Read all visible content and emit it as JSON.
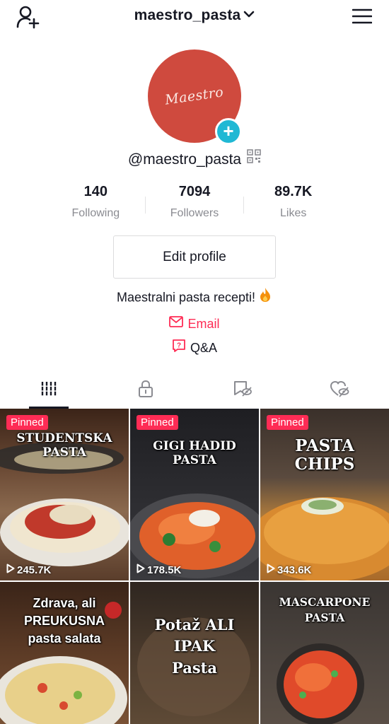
{
  "header": {
    "username": "maestro_pasta",
    "icons": {
      "left": "add-user-icon",
      "dropdown": "chevron-down-icon",
      "right": "hamburger-menu-icon"
    }
  },
  "profile": {
    "avatar_text": "Maestro",
    "handle": "@maestro_pasta",
    "bio": "Maestralni pasta recepti!",
    "bio_emoji": "fire-icon",
    "edit_label": "Edit profile",
    "email_label": "Email",
    "qa_label": "Q&A"
  },
  "stats": [
    {
      "value": "140",
      "label": "Following"
    },
    {
      "value": "7094",
      "label": "Followers"
    },
    {
      "value": "89.7K",
      "label": "Likes"
    }
  ],
  "tabs": [
    "videos-grid-icon",
    "private-lock-icon",
    "reposts-icon",
    "liked-hidden-icon"
  ],
  "videos": [
    {
      "pinned": "Pinned",
      "title": "STUDENTSKA PASTA",
      "views": "245.7K"
    },
    {
      "pinned": "Pinned",
      "title": "GIGI HADID PASTA",
      "views": "178.5K"
    },
    {
      "pinned": "Pinned",
      "title": "PASTA CHIPS",
      "views": "343.6K"
    },
    {
      "title": "Zdrava, ali PREUKUSNA pasta salata"
    },
    {
      "title": "Potaž ALI IPAK Pasta"
    },
    {
      "title": "MASCARPONE PASTA"
    }
  ],
  "colors": {
    "accent": "#fe2c55",
    "avatar_bg": "#cf4a3e",
    "plus_badge": "#20b8d4",
    "text": "#161823",
    "muted": "#8a8b91"
  }
}
